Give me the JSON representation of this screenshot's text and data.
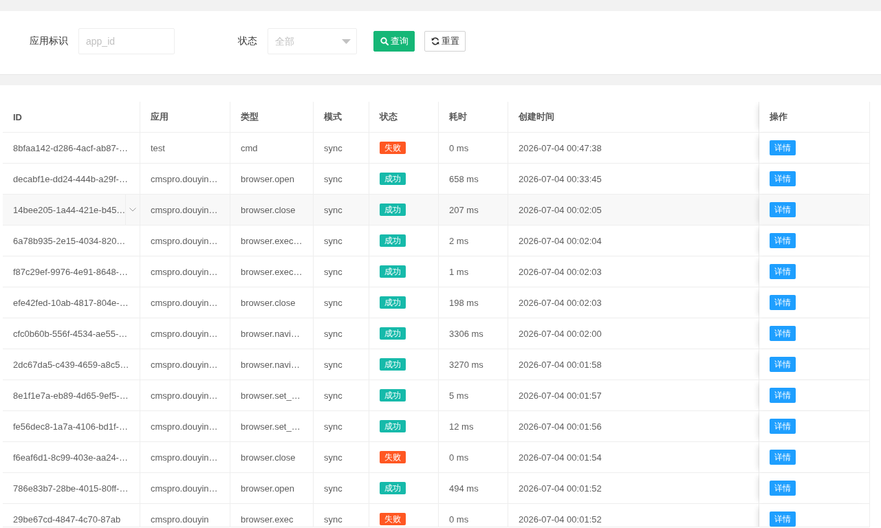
{
  "filters": {
    "app_id": {
      "label": "应用标识",
      "placeholder": "app_id"
    },
    "status": {
      "label": "状态",
      "placeholder": "全部"
    },
    "buttons": [
      {
        "kind": "search",
        "label": "查询"
      },
      {
        "kind": "reset",
        "label": "重置"
      }
    ]
  },
  "table": {
    "columns": [
      "ID",
      "应用",
      "类型",
      "模式",
      "状态",
      "耗时",
      "创建时间",
      "操作"
    ],
    "rows": [
      {
        "id": "8bfaa142-d286-4acf-ab87-…",
        "app": "test",
        "type": "cmd",
        "mode": "sync",
        "status": {
          "text": "失败",
          "color": "#ff5722"
        },
        "duration": "0 ms",
        "created": "2026-07-04 00:47:38",
        "action": "详情",
        "highlighted": false
      },
      {
        "id": "decabf1e-dd24-444b-a29f-…",
        "app": "cmspro.douyin…",
        "type": "browser.open",
        "mode": "sync",
        "status": {
          "text": "成功",
          "color": "#16baaa"
        },
        "duration": "658 ms",
        "created": "2026-07-04 00:33:45",
        "action": "详情",
        "highlighted": false
      },
      {
        "id": "14bee205-1a44-421e-b45…",
        "app": "cmspro.douyin…",
        "type": "browser.close",
        "mode": "sync",
        "status": {
          "text": "成功",
          "color": "#16baaa"
        },
        "duration": "207 ms",
        "created": "2026-07-04 00:02:05",
        "action": "详情",
        "highlighted": true
      },
      {
        "id": "6a78b935-2e15-4034-820…",
        "app": "cmspro.douyin…",
        "type": "browser.exec…",
        "mode": "sync",
        "status": {
          "text": "成功",
          "color": "#16baaa"
        },
        "duration": "2 ms",
        "created": "2026-07-04 00:02:04",
        "action": "详情",
        "highlighted": false
      },
      {
        "id": "f87c29ef-9976-4e91-8648-…",
        "app": "cmspro.douyin…",
        "type": "browser.exec…",
        "mode": "sync",
        "status": {
          "text": "成功",
          "color": "#16baaa"
        },
        "duration": "1 ms",
        "created": "2026-07-04 00:02:03",
        "action": "详情",
        "highlighted": false
      },
      {
        "id": "efe42fed-10ab-4817-804e-…",
        "app": "cmspro.douyin…",
        "type": "browser.close",
        "mode": "sync",
        "status": {
          "text": "成功",
          "color": "#16baaa"
        },
        "duration": "198 ms",
        "created": "2026-07-04 00:02:03",
        "action": "详情",
        "highlighted": false
      },
      {
        "id": "cfc0b60b-556f-4534-ae55-…",
        "app": "cmspro.douyin…",
        "type": "browser.navi…",
        "mode": "sync",
        "status": {
          "text": "成功",
          "color": "#16baaa"
        },
        "duration": "3306 ms",
        "created": "2026-07-04 00:02:00",
        "action": "详情",
        "highlighted": false
      },
      {
        "id": "2dc67da5-c439-4659-a8c5…",
        "app": "cmspro.douyin…",
        "type": "browser.navi…",
        "mode": "sync",
        "status": {
          "text": "成功",
          "color": "#16baaa"
        },
        "duration": "3270 ms",
        "created": "2026-07-04 00:01:58",
        "action": "详情",
        "highlighted": false
      },
      {
        "id": "8e1f1e7a-eb89-4d65-9ef5-…",
        "app": "cmspro.douyin…",
        "type": "browser.set_…",
        "mode": "sync",
        "status": {
          "text": "成功",
          "color": "#16baaa"
        },
        "duration": "5 ms",
        "created": "2026-07-04 00:01:57",
        "action": "详情",
        "highlighted": false
      },
      {
        "id": "fe56dec8-1a7a-4106-bd1f-…",
        "app": "cmspro.douyin…",
        "type": "browser.set_…",
        "mode": "sync",
        "status": {
          "text": "成功",
          "color": "#16baaa"
        },
        "duration": "12 ms",
        "created": "2026-07-04 00:01:56",
        "action": "详情",
        "highlighted": false
      },
      {
        "id": "f6eaf6d1-8c99-403e-aa24-…",
        "app": "cmspro.douyin…",
        "type": "browser.close",
        "mode": "sync",
        "status": {
          "text": "失败",
          "color": "#ff5722"
        },
        "duration": "0 ms",
        "created": "2026-07-04 00:01:54",
        "action": "详情",
        "highlighted": false
      },
      {
        "id": "786e83b7-28be-4015-80ff-…",
        "app": "cmspro.douyin…",
        "type": "browser.open",
        "mode": "sync",
        "status": {
          "text": "成功",
          "color": "#16baaa"
        },
        "duration": "494 ms",
        "created": "2026-07-04 00:01:52",
        "action": "详情",
        "highlighted": false
      },
      {
        "id": "29be67cd-4847-4c70-87ab",
        "app": "cmspro.douyin",
        "type": "browser.exec",
        "mode": "sync",
        "status": {
          "text": "失败",
          "color": "#ff5722"
        },
        "duration": "0 ms",
        "created": "2026-07-04 00:01:52",
        "action": "详情",
        "highlighted": false
      }
    ]
  }
}
